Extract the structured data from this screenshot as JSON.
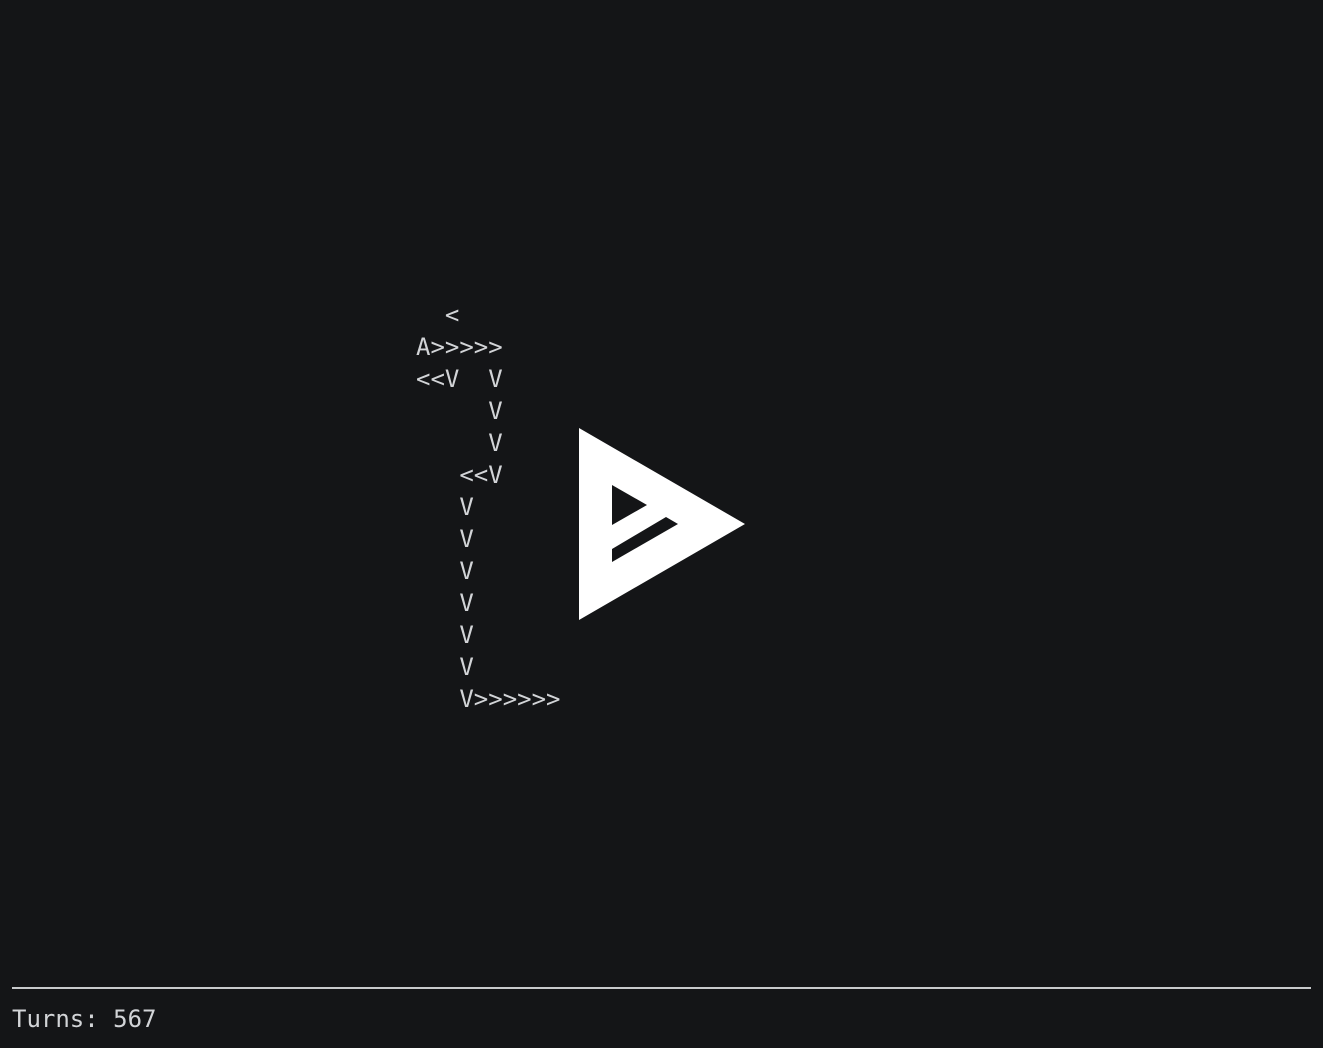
{
  "board": {
    "rows": [
      "  <",
      "A>>>>>",
      "<<V  V",
      "     V",
      "     V",
      "   <<V",
      "   V",
      "   V",
      "   V",
      "   V",
      "   V",
      "   V",
      "   V>>>>>>"
    ]
  },
  "overlay": {
    "icon": "play-logo-icon",
    "color": "#ffffff"
  },
  "status": {
    "turns_text": "Turns: 567"
  },
  "colors": {
    "background": "#141517",
    "text": "#d2d4d7",
    "divider": "#c8cacc"
  }
}
